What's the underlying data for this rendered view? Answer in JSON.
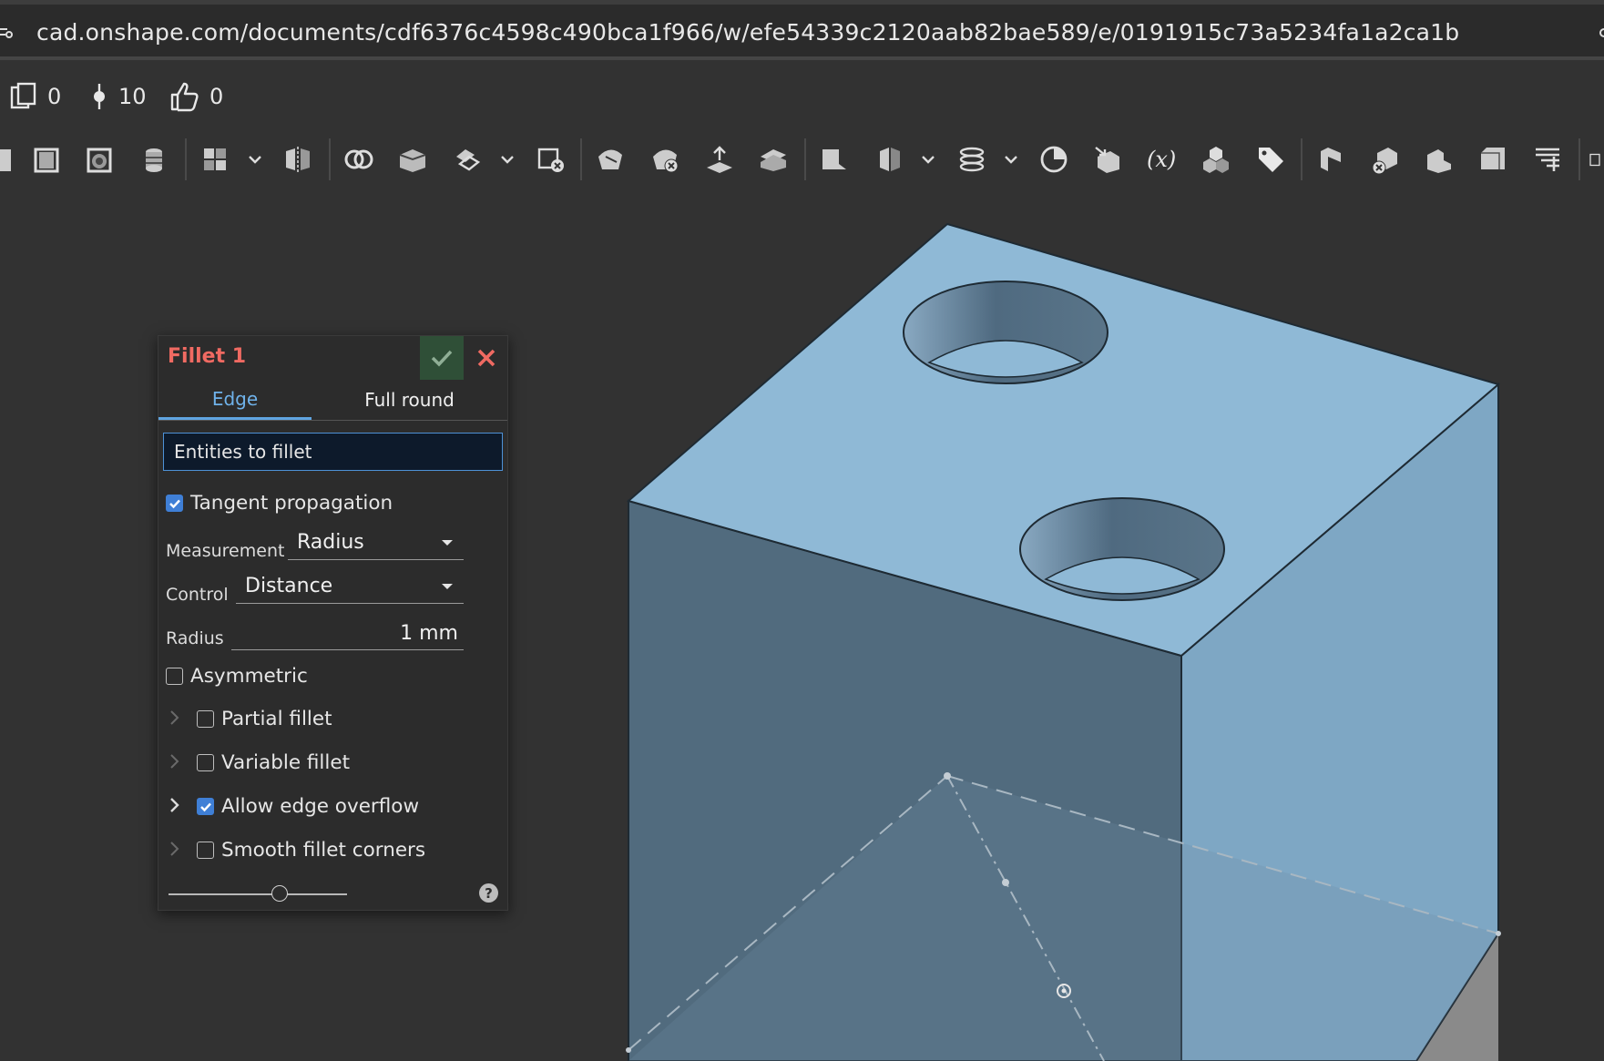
{
  "browser": {
    "url": "cad.onshape.com/documents/cdf6376c4598c490bca1f966/w/efe54339c2120aab82bae589/e/0191915c73a5234fa1a2ca1b"
  },
  "document_stats": {
    "copies": "0",
    "revisions": "10",
    "likes": "0"
  },
  "toolbar": {
    "icons": [
      "sketch-icon",
      "extrude-icon",
      "revolve-icon",
      "sweep-icon",
      "pattern-icon",
      "chevron-down-icon",
      "mirror-icon",
      "boolean-icon",
      "split-icon",
      "transform-icon",
      "chevron-down-icon",
      "delete-part-icon",
      "move-face-icon",
      "delete-face-icon",
      "offset-surface-icon",
      "thicken-icon",
      "plane-icon",
      "helix-icon",
      "chevron-down-icon",
      "curve-icon",
      "chevron-down-icon",
      "mate-connector-icon",
      "replace-face-icon",
      "variable-icon",
      "part-studio-icon",
      "tag-icon",
      "fillet-icon",
      "remove-icon",
      "chamfer-icon",
      "shell-icon",
      "sheet-metal-icon"
    ]
  },
  "feature_dialog": {
    "title": "Fillet 1",
    "tabs": {
      "edge": "Edge",
      "full_round": "Full round"
    },
    "entities_label": "Entities to fillet",
    "tangent_propagation": {
      "label": "Tangent propagation",
      "checked": true
    },
    "measurement": {
      "label": "Measurement",
      "value": "Radius"
    },
    "control": {
      "label": "Control",
      "value": "Distance"
    },
    "radius": {
      "label": "Radius",
      "value": "1 mm"
    },
    "asymmetric": {
      "label": "Asymmetric",
      "checked": false
    },
    "partial_fillet": {
      "label": "Partial fillet",
      "checked": false
    },
    "variable_fillet": {
      "label": "Variable fillet",
      "checked": false
    },
    "allow_edge_overflow": {
      "label": "Allow edge overflow",
      "checked": true
    },
    "smooth_fillet_corners": {
      "label": "Smooth fillet corners",
      "checked": false
    },
    "slider_level": 0.62,
    "help": "?"
  },
  "colors": {
    "title_red": "#f06a62",
    "active_tab_blue": "#6fb2ea",
    "part_top": "#8fb9d6",
    "part_front": "#516b7e",
    "part_right": "#7ea7c4"
  }
}
